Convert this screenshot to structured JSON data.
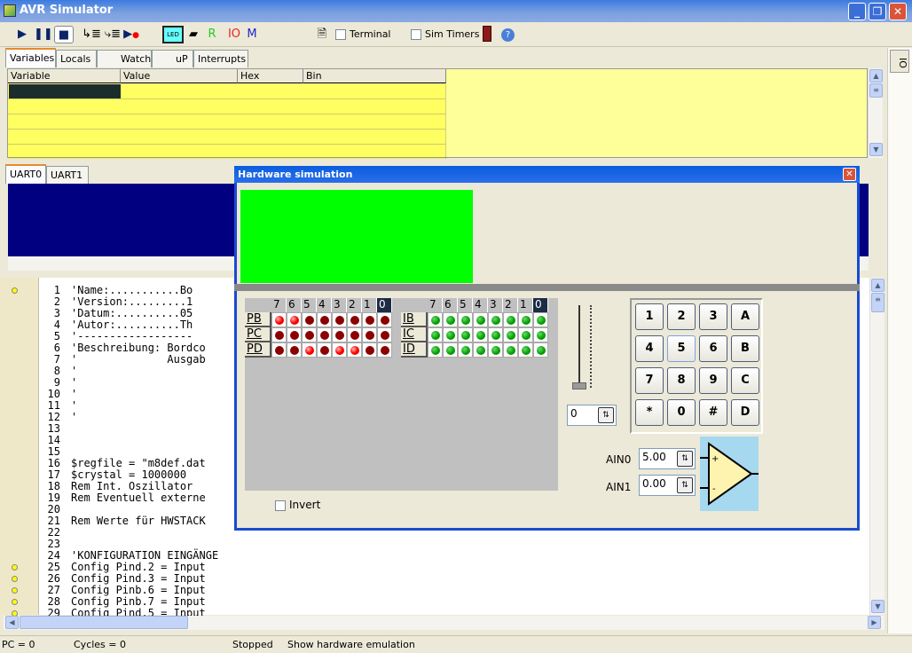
{
  "window": {
    "title": "AVR Simulator"
  },
  "toolbar": {
    "terminal": "Terminal",
    "sim_timers": "Sim Timers",
    "led": "LED",
    "r": "R",
    "io": "IO",
    "m": "M"
  },
  "tabs": [
    "Variables",
    "Locals",
    "Watch",
    "uP",
    "Interrupts"
  ],
  "grid": {
    "columns": [
      "Variable",
      "Value",
      "Hex",
      "Bin"
    ]
  },
  "uart_tabs": [
    "UART0",
    "UART1"
  ],
  "side_tab": "IO",
  "code": {
    "lines": [
      "'Name:...........Bo",
      "'Version:.........1",
      "'Datum:..........05",
      "'Autor:..........Th",
      "'------------------",
      "'Beschreibung: Bordco",
      "'              Ausgab",
      "'",
      "'",
      "'",
      "'",
      "'",
      "",
      "",
      "",
      "$regfile = \"m8def.dat",
      "$crystal = 1000000",
      "Rem Int. Oszillator",
      "Rem Eventuell externe",
      "",
      "Rem Werte für HWSTACK",
      "",
      "",
      "'KONFIGURATION EINGÄNGE",
      "Config Pind.2 = Input",
      "Config Pind.3 = Input",
      "Config Pinb.6 = Input",
      "Config Pinb.7 = Input",
      "Config Pind.5 = Input"
    ],
    "breakpoint_lines": [
      1,
      25,
      26,
      27,
      28,
      29
    ]
  },
  "status": {
    "pc": "PC = 0",
    "cycles": "Cycles = 0",
    "state": "Stopped",
    "hint": "Show hardware emulation"
  },
  "dialog": {
    "title": "Hardware simulation",
    "lcd_color": "#00ff00",
    "bits": [
      "7",
      "6",
      "5",
      "4",
      "3",
      "2",
      "1",
      "0"
    ],
    "outputs": [
      {
        "name": "PB",
        "on": [
          7,
          6
        ]
      },
      {
        "name": "PC",
        "on": []
      },
      {
        "name": "PD",
        "on": [
          5,
          3,
          2
        ]
      }
    ],
    "inputs": [
      {
        "name": "IB"
      },
      {
        "name": "IC"
      },
      {
        "name": "ID"
      }
    ],
    "invert": "Invert",
    "slider_value": "0",
    "keypad": [
      "1",
      "2",
      "3",
      "A",
      "4",
      "5",
      "6",
      "B",
      "7",
      "8",
      "9",
      "C",
      "*",
      "0",
      "#",
      "D"
    ],
    "ain0_label": "AIN0",
    "ain0": "5.00",
    "ain1_label": "AIN1",
    "ain1": "0.00",
    "plus": "+",
    "minus": "-"
  }
}
